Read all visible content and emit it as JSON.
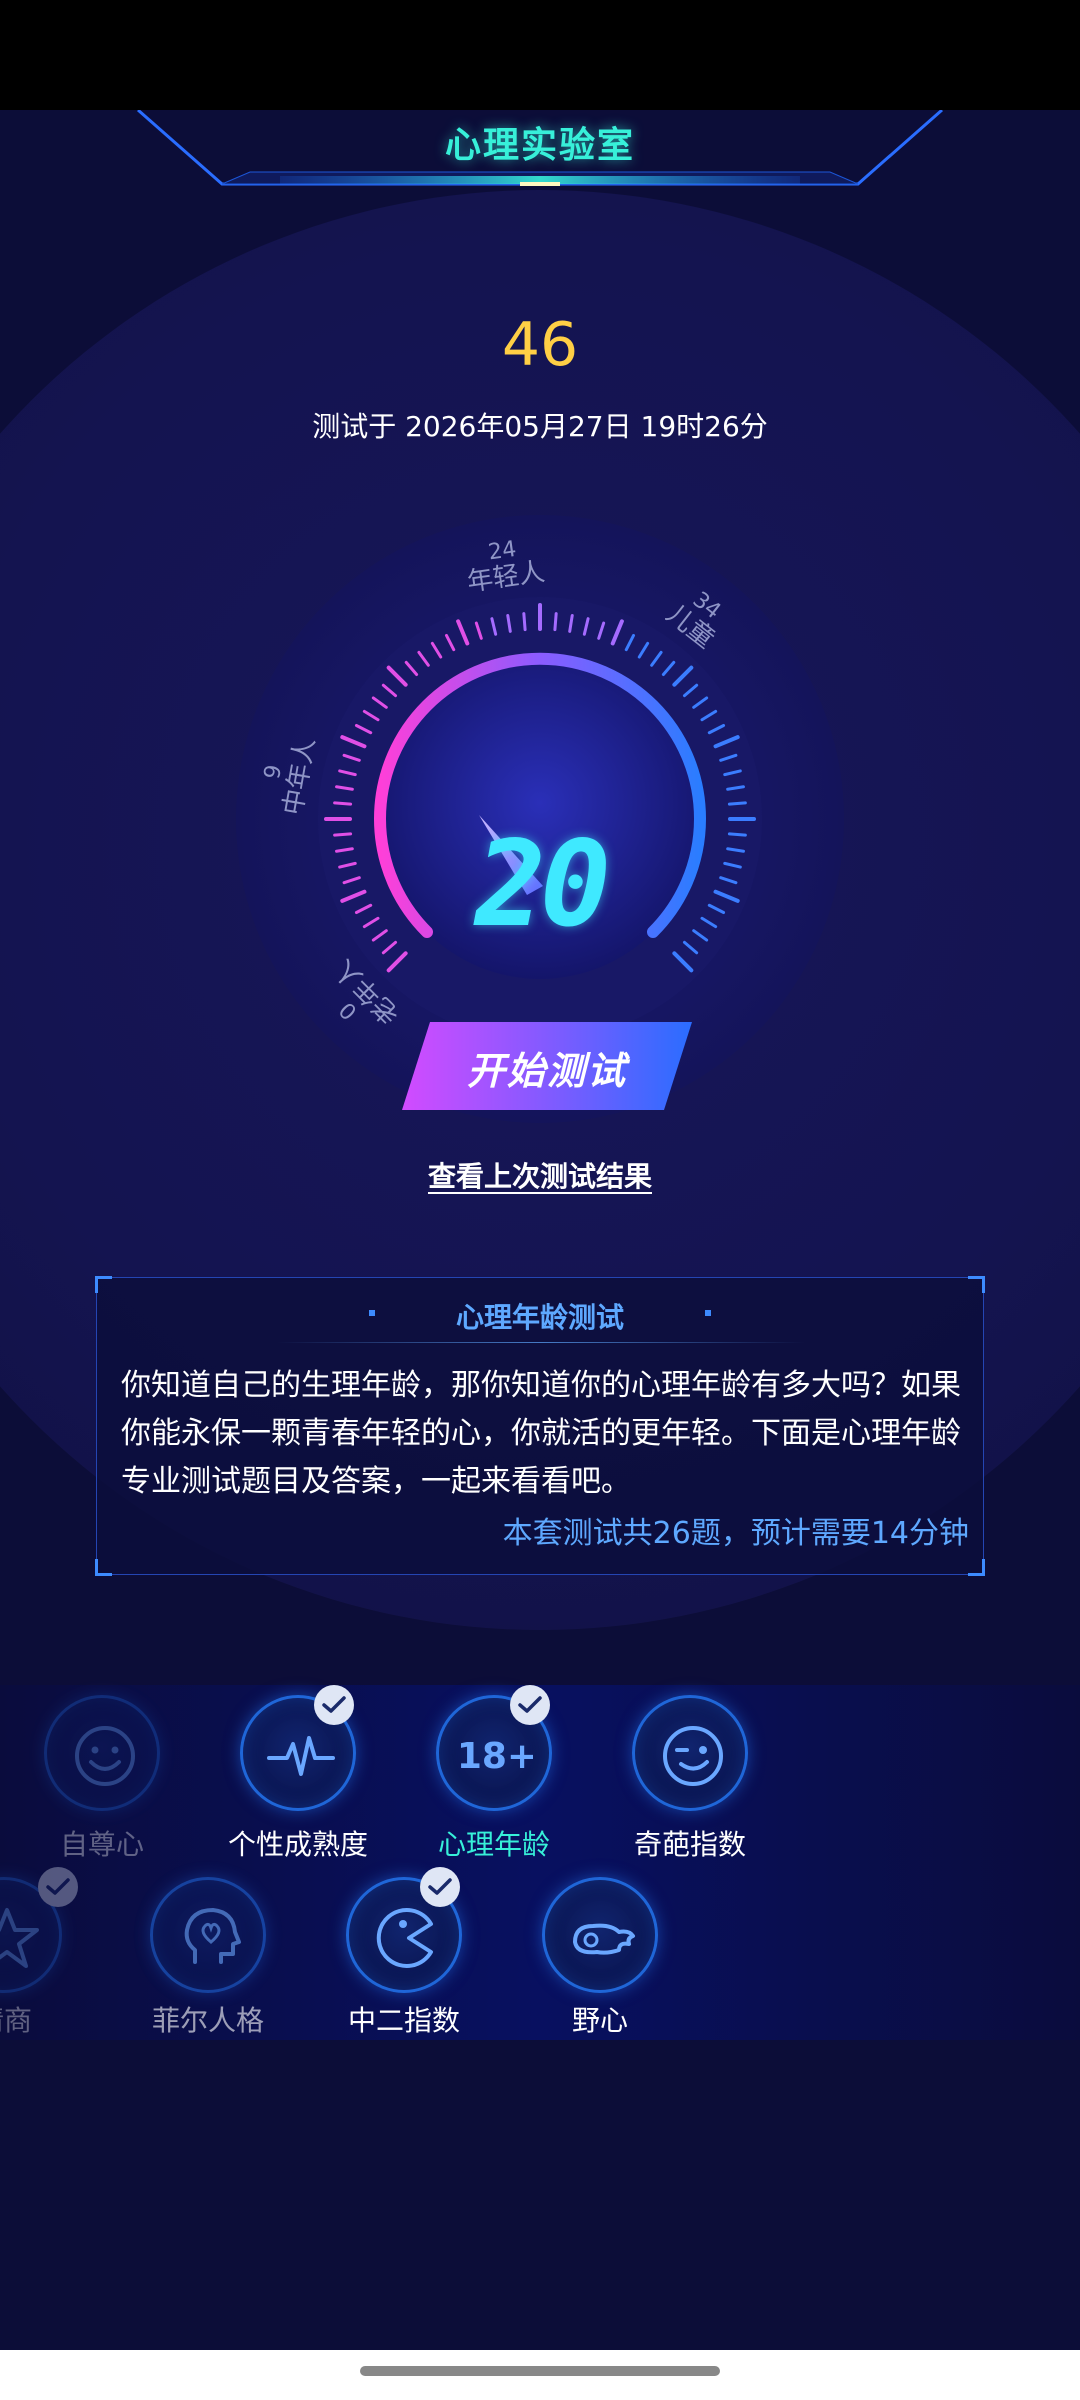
{
  "header": {
    "title": "心理实验室"
  },
  "result": {
    "score": "46",
    "tested_at": "测试于 2026年05月27日 19时26分"
  },
  "gauge": {
    "value": "20",
    "labels": [
      {
        "age": "0",
        "name": "老年人"
      },
      {
        "age": "9",
        "name": "中年人"
      },
      {
        "age": "24",
        "name": "年轻人"
      },
      {
        "age": "34",
        "name": "儿童"
      }
    ]
  },
  "actions": {
    "start_test": "开始测试",
    "view_last_result": "查看上次测试结果"
  },
  "info_card": {
    "title": "心理年龄测试",
    "body": "你知道自己的生理年龄，那你知道你的心理年龄有多大吗？如果你能永保一颗青春年轻的心，你就活的更年轻。下面是心理年龄专业测试题目及答案，一起来看看吧。",
    "footer": "本套测试共26题，预计需要14分钟"
  },
  "tests": [
    {
      "label": "自尊心",
      "icon": "smile-icon",
      "completed": false,
      "active": false
    },
    {
      "label": "个性成熟度",
      "icon": "heartbeat-icon",
      "completed": true,
      "active": false
    },
    {
      "label": "心理年龄",
      "icon": "eighteen-plus-icon",
      "completed": true,
      "active": true
    },
    {
      "label": "奇葩指数",
      "icon": "wink-icon",
      "completed": false,
      "active": false
    },
    {
      "label": "情商",
      "icon": "star-icon",
      "completed": true,
      "active": false
    },
    {
      "label": "菲尔人格",
      "icon": "head-heart-icon",
      "completed": false,
      "active": false
    },
    {
      "label": "中二指数",
      "icon": "pacman-icon",
      "completed": true,
      "active": false
    },
    {
      "label": "野心",
      "icon": "wing-icon",
      "completed": false,
      "active": false
    }
  ],
  "colors": {
    "accent": "#37f0d9",
    "score": "#ffcf45",
    "link": "#5ea8ff",
    "gauge_digits": "#3fe9ff"
  }
}
